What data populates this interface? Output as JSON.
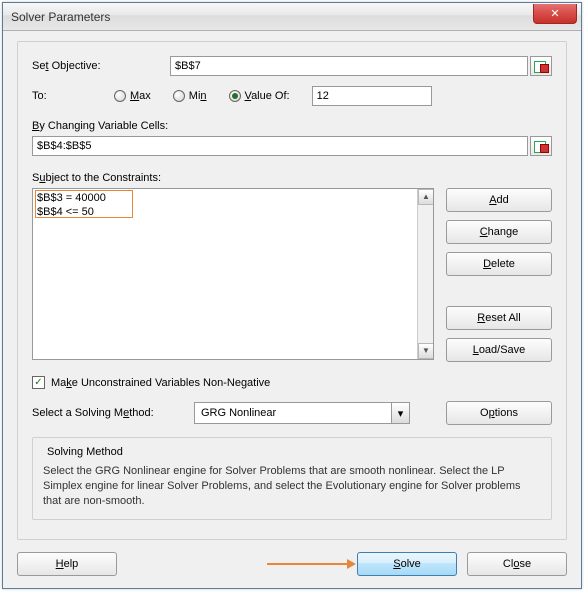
{
  "window": {
    "title": "Solver Parameters"
  },
  "objective": {
    "label_pre": "Se",
    "label_u": "t",
    "label_post": " Objective:",
    "value": "$B$7"
  },
  "to": {
    "label": "To:",
    "max_u": "M",
    "max_t": "ax",
    "min_u": "n",
    "min_pre": "Mi",
    "valueof_u": "V",
    "valueof_t": "alue Of:",
    "selected": "valueof",
    "value": "12"
  },
  "changing": {
    "label_u": "B",
    "label_t": "y Changing Variable Cells:",
    "value": "$B$4:$B$5"
  },
  "constraints": {
    "label_u": "u",
    "label_pre": "S",
    "label_post": "bject to the Constraints:",
    "items": [
      "$B$3 = 40000",
      "$B$4 <= 50"
    ]
  },
  "buttons": {
    "add_u": "A",
    "add_t": "dd",
    "change_u": "C",
    "change_t": "hange",
    "delete_u": "D",
    "delete_t": "elete",
    "reset_u": "R",
    "reset_t": "eset All",
    "loadsave_u": "L",
    "loadsave_t": "oad/Save",
    "options_u": "p",
    "options_pre": "O",
    "options_post": "tions",
    "help_u": "H",
    "help_t": "elp",
    "solve_u": "S",
    "solve_t": "olve",
    "close_pre": "Cl",
    "close_u": "o",
    "close_t": "se"
  },
  "nonneg": {
    "checked": true,
    "label_u": "K",
    "label_pre": "Ma",
    "label_mid": "k",
    "label_post": "e Unconstrained Variables Non-Negative"
  },
  "method": {
    "label_u": "E",
    "label_pre": "Select a Solving M",
    "label_post": "thod:",
    "value": "GRG Nonlinear"
  },
  "solving_method": {
    "title": "Solving Method",
    "desc": "Select the GRG Nonlinear engine for Solver Problems that are smooth nonlinear. Select the LP Simplex engine for linear Solver Problems, and select the Evolutionary engine for Solver problems that are non-smooth."
  }
}
